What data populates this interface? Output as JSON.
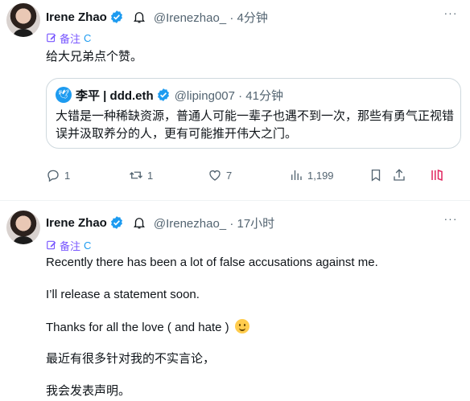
{
  "tweets": [
    {
      "author": "Irene Zhao",
      "handle_time": "@Irenezhao_ · 4分钟",
      "note_label": "备注",
      "refresh_glyph": "C",
      "text": "给大兄弟点个赞。",
      "quote": {
        "avatar_glyph": "🕊",
        "author": "李平 | ddd.eth",
        "handle_time": "@liping007 · 41分钟",
        "text": "大错是一种稀缺资源，普通人可能一辈子也遇不到一次，那些有勇气正视错误并汲取养分的人，更有可能推开伟大之门。"
      },
      "actions": {
        "reply_count": "1",
        "retweet_count": "1",
        "like_count": "7",
        "views_count": "1,199"
      }
    },
    {
      "author": "Irene Zhao",
      "handle_time": "@Irenezhao_ · 17小时",
      "note_label": "备注",
      "refresh_glyph": "C",
      "lines": [
        "Recently there has been a lot of false accusations against me.",
        "I’ll release a statement soon.",
        "Thanks for all the love ( and hate )",
        "最近有很多针对我的不实言论，",
        "我会发表声明。"
      ]
    }
  ],
  "more_glyph": "···",
  "colors": {
    "accent": "#1d9bf0",
    "note": "#7856ff",
    "secondary": "#536471",
    "border": "#cfd9de",
    "text": "#0f1419"
  }
}
